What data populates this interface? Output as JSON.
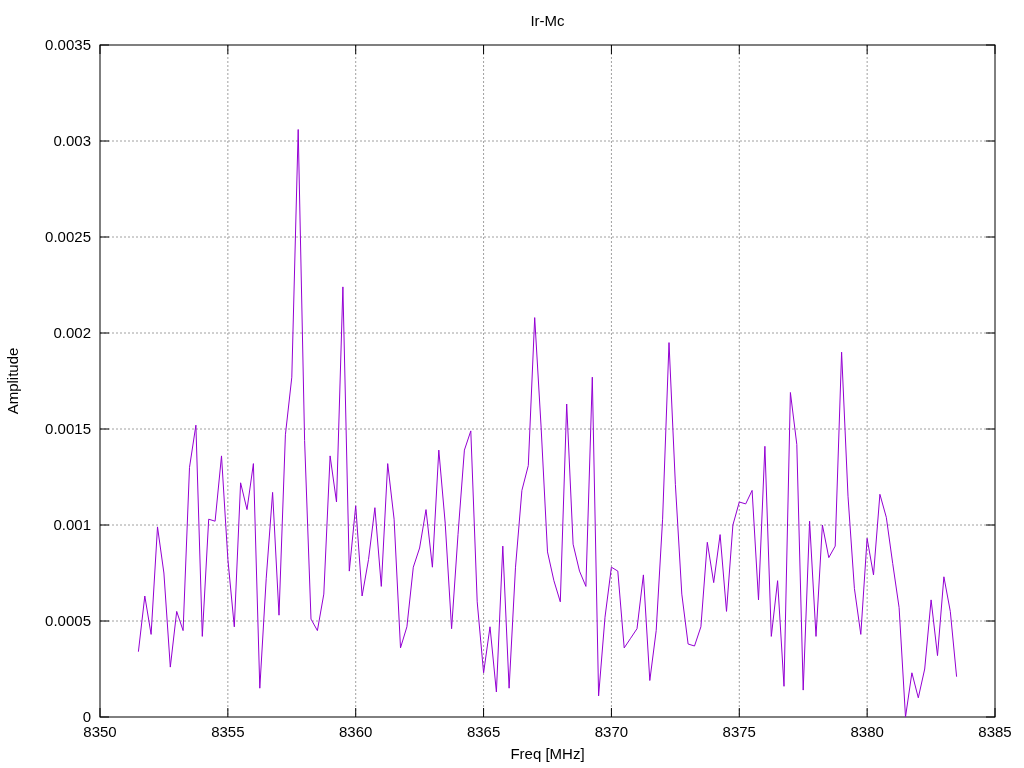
{
  "chart_data": {
    "type": "line",
    "title": "Ir-Mc",
    "xlabel": "Freq [MHz]",
    "ylabel": "Amplitude",
    "grid": true,
    "xlim": [
      8350,
      8385
    ],
    "ylim": [
      0,
      0.0035
    ],
    "xticks": [
      8350,
      8355,
      8360,
      8365,
      8370,
      8375,
      8380,
      8385
    ],
    "yticks": [
      {
        "value": 0,
        "label": "0"
      },
      {
        "value": 0.0005,
        "label": "0.0005"
      },
      {
        "value": 0.001,
        "label": "0.001"
      },
      {
        "value": 0.0015,
        "label": "0.0015"
      },
      {
        "value": 0.002,
        "label": "0.002"
      },
      {
        "value": 0.0025,
        "label": "0.0025"
      },
      {
        "value": 0.003,
        "label": "0.003"
      },
      {
        "value": 0.0035,
        "label": "0.0035"
      }
    ],
    "x": [
      8351.5,
      8351.75,
      8352,
      8352.25,
      8352.5,
      8352.75,
      8353,
      8353.25,
      8353.5,
      8353.75,
      8354,
      8354.25,
      8354.5,
      8354.75,
      8355,
      8355.25,
      8355.5,
      8355.75,
      8356,
      8356.25,
      8356.5,
      8356.75,
      8357,
      8357.25,
      8357.5,
      8357.75,
      8358,
      8358.25,
      8358.5,
      8358.75,
      8359,
      8359.25,
      8359.5,
      8359.75,
      8360,
      8360.25,
      8360.5,
      8360.75,
      8361,
      8361.25,
      8361.5,
      8361.75,
      8362,
      8362.25,
      8362.5,
      8362.75,
      8363,
      8363.25,
      8363.5,
      8363.75,
      8364,
      8364.25,
      8364.5,
      8364.75,
      8365,
      8365.25,
      8365.5,
      8365.75,
      8366,
      8366.25,
      8366.5,
      8366.75,
      8367,
      8367.25,
      8367.5,
      8367.75,
      8368,
      8368.25,
      8368.5,
      8368.75,
      8369,
      8369.25,
      8369.5,
      8369.75,
      8370,
      8370.25,
      8370.5,
      8370.75,
      8371,
      8371.25,
      8371.5,
      8371.75,
      8372,
      8372.25,
      8372.5,
      8372.75,
      8373,
      8373.25,
      8373.5,
      8373.75,
      8374,
      8374.25,
      8374.5,
      8374.75,
      8375,
      8375.25,
      8375.5,
      8375.75,
      8376,
      8376.25,
      8376.5,
      8376.75,
      8377,
      8377.25,
      8377.5,
      8377.75,
      8378,
      8378.25,
      8378.5,
      8378.75,
      8379,
      8379.25,
      8379.5,
      8379.75,
      8380,
      8380.25,
      8380.5,
      8380.75,
      8381,
      8381.25,
      8381.5,
      8381.75,
      8382,
      8382.25,
      8382.5,
      8382.75,
      8383,
      8383.25,
      8383.5
    ],
    "series": [
      {
        "color": "#9400d3",
        "values": [
          0.00034,
          0.00063,
          0.00043,
          0.00099,
          0.00075,
          0.00026,
          0.00055,
          0.00045,
          0.0013,
          0.00152,
          0.00042,
          0.00103,
          0.00102,
          0.00136,
          0.00082,
          0.00047,
          0.00122,
          0.00108,
          0.00132,
          0.00015,
          0.00072,
          0.00117,
          0.00053,
          0.00147,
          0.00177,
          0.00306,
          0.00144,
          0.00051,
          0.00045,
          0.00064,
          0.00136,
          0.00112,
          0.00224,
          0.00076,
          0.0011,
          0.00063,
          0.00082,
          0.00109,
          0.00068,
          0.00132,
          0.00103,
          0.00036,
          0.00047,
          0.00078,
          0.00088,
          0.00108,
          0.00078,
          0.00139,
          0.00101,
          0.00046,
          0.00095,
          0.00139,
          0.00149,
          0.0006,
          0.00023,
          0.00047,
          0.00013,
          0.00089,
          0.00015,
          0.00078,
          0.00118,
          0.00131,
          0.00208,
          0.00151,
          0.00086,
          0.00071,
          0.0006,
          0.00163,
          0.0009,
          0.00076,
          0.00068,
          0.00177,
          0.00011,
          0.00052,
          0.00078,
          0.00076,
          0.00036,
          0.00041,
          0.00046,
          0.00074,
          0.00019,
          0.00045,
          0.00103,
          0.00195,
          0.00121,
          0.00064,
          0.00038,
          0.00037,
          0.00047,
          0.00091,
          0.0007,
          0.00095,
          0.00055,
          0.001,
          0.00112,
          0.00111,
          0.00118,
          0.00061,
          0.00141,
          0.00042,
          0.00071,
          0.00016,
          0.00169,
          0.00142,
          0.00014,
          0.00102,
          0.00042,
          0.001,
          0.00083,
          0.00089,
          0.0019,
          0.00115,
          0.00067,
          0.00043,
          0.00093,
          0.00074,
          0.00116,
          0.00104,
          0.0008,
          0.00057,
          0,
          0.00023,
          0.0001,
          0.00025,
          0.00061,
          0.00032,
          0.00073,
          0.00055,
          0.00021
        ]
      }
    ]
  }
}
